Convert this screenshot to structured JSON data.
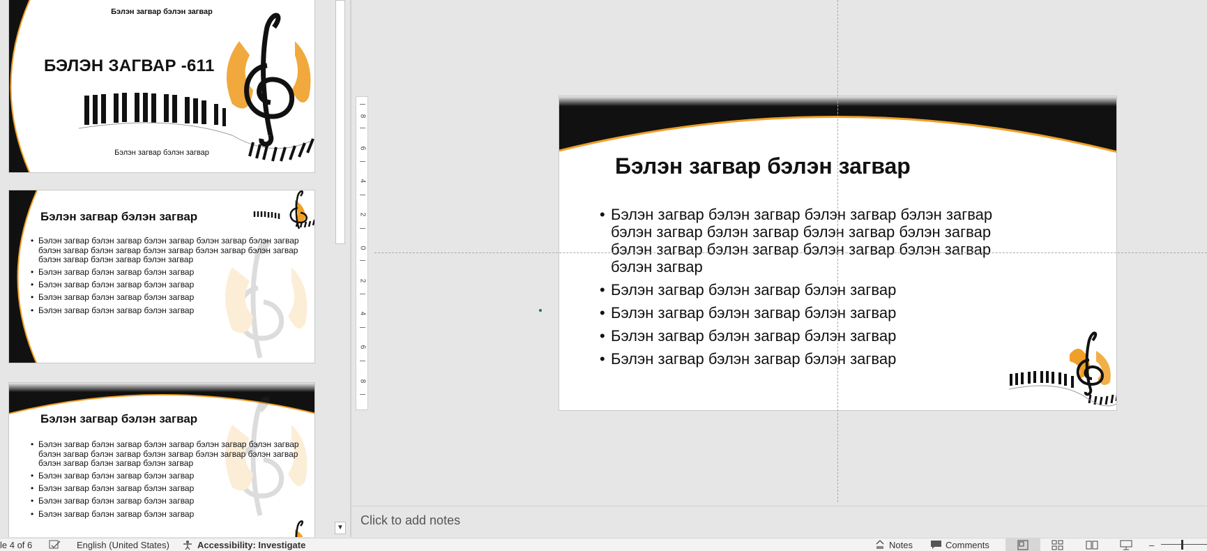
{
  "thumbnails": [
    {
      "subtitle_top": "Бэлэн загвар бэлэн загвар",
      "title": "БЭЛЭН ЗАГВАР -611",
      "subtitle_bottom": "Бэлэн загвар бэлэн загвар"
    },
    {
      "title": "Бэлэн загвар бэлэн загвар",
      "bullets": [
        "Бэлэн загвар бэлэн загвар бэлэн загвар бэлэн загвар бэлэн загвар бэлэн загвар бэлэн загвар бэлэн загвар бэлэн загвар бэлэн загвар бэлэн загвар бэлэн загвар бэлэн загвар",
        "Бэлэн загвар бэлэн загвар бэлэн загвар",
        "Бэлэн загвар бэлэн загвар бэлэн загвар",
        "Бэлэн загвар бэлэн загвар бэлэн загвар",
        "Бэлэн загвар бэлэн загвар бэлэн загвар"
      ]
    },
    {
      "title": "Бэлэн загвар бэлэн загвар",
      "bullets": [
        "Бэлэн загвар бэлэн загвар бэлэн загвар бэлэн загвар бэлэн загвар бэлэн загвар бэлэн загвар бэлэн загвар бэлэн загвар бэлэн загвар бэлэн загвар бэлэн загвар бэлэн загвар",
        "Бэлэн загвар бэлэн загвар бэлэн загвар",
        "Бэлэн загвар бэлэн загвар бэлэн загвар",
        "Бэлэн загвар бэлэн загвар бэлэн загвар",
        "Бэлэн загвар бэлэн загвар бэлэн загвар"
      ]
    }
  ],
  "ruler_labels": [
    "8",
    "6",
    "4",
    "2",
    "0",
    "2",
    "4",
    "6",
    "8"
  ],
  "slide": {
    "title": "Бэлэн загвар бэлэн загвар",
    "bullets": [
      "Бэлэн загвар бэлэн загвар бэлэн загвар бэлэн загвар бэлэн загвар бэлэн загвар бэлэн загвар бэлэн загвар бэлэн загвар бэлэн загвар бэлэн загвар бэлэн загвар бэлэн загвар",
      "Бэлэн загвар бэлэн загвар бэлэн загвар",
      "Бэлэн загвар бэлэн загвар бэлэн загвар",
      "Бэлэн загвар бэлэн загвар бэлэн загвар",
      "Бэлэн загвар бэлэн загвар бэлэн загвар"
    ]
  },
  "notes": {
    "placeholder": "Click to add notes"
  },
  "status": {
    "slide_indicator": "le 4 of 6",
    "language": "English (United States)",
    "accessibility": "Accessibility: Investigate",
    "notes_label": "Notes",
    "comments_label": "Comments"
  },
  "colors": {
    "accent": "#f0a028",
    "dark": "#111111",
    "background": "#e6e6e6"
  },
  "icons": [
    "spellcheck-icon",
    "accessibility-icon",
    "notes-icon",
    "comments-icon",
    "normal-view-icon",
    "slide-sorter-icon",
    "reading-view-icon",
    "slideshow-icon",
    "zoom-out-icon"
  ]
}
